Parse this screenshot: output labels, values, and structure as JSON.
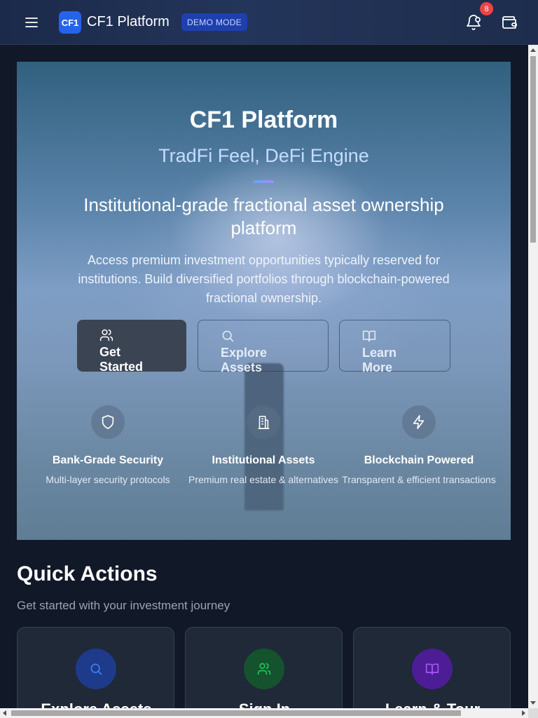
{
  "header": {
    "logo_badge": "CF1",
    "brand": "CF1 Platform",
    "mode_badge": "DEMO MODE",
    "notification_count": "8"
  },
  "hero": {
    "title": "CF1 Platform",
    "subtitle": "TradFi Feel, DeFi Engine",
    "headline": "Institutional-grade fractional asset ownership platform",
    "description": "Access premium investment opportunities typically reserved for institutions. Build diversified portfolios through blockchain-powered fractional ownership.",
    "buttons": [
      {
        "label": "Get Started",
        "icon": "users-icon"
      },
      {
        "label": "Explore Assets",
        "icon": "search-icon"
      },
      {
        "label": "Learn More",
        "icon": "book-icon"
      }
    ],
    "features": [
      {
        "title": "Bank-Grade Security",
        "desc": "Multi-layer security protocols",
        "icon": "shield-icon"
      },
      {
        "title": "Institutional Assets",
        "desc": "Premium real estate & alternatives",
        "icon": "building-icon"
      },
      {
        "title": "Blockchain Powered",
        "desc": "Transparent & efficient transactions",
        "icon": "lightning-icon"
      }
    ]
  },
  "quick_actions": {
    "title": "Quick Actions",
    "subtitle": "Get started with your investment journey",
    "cards": [
      {
        "label": "Explore Assets",
        "icon": "search-icon",
        "color": "#3b82f6"
      },
      {
        "label": "Sign In",
        "icon": "users-icon",
        "color": "#22c55e"
      },
      {
        "label": "Learn & Tour",
        "icon": "book-icon",
        "color": "#a855f7"
      }
    ]
  }
}
